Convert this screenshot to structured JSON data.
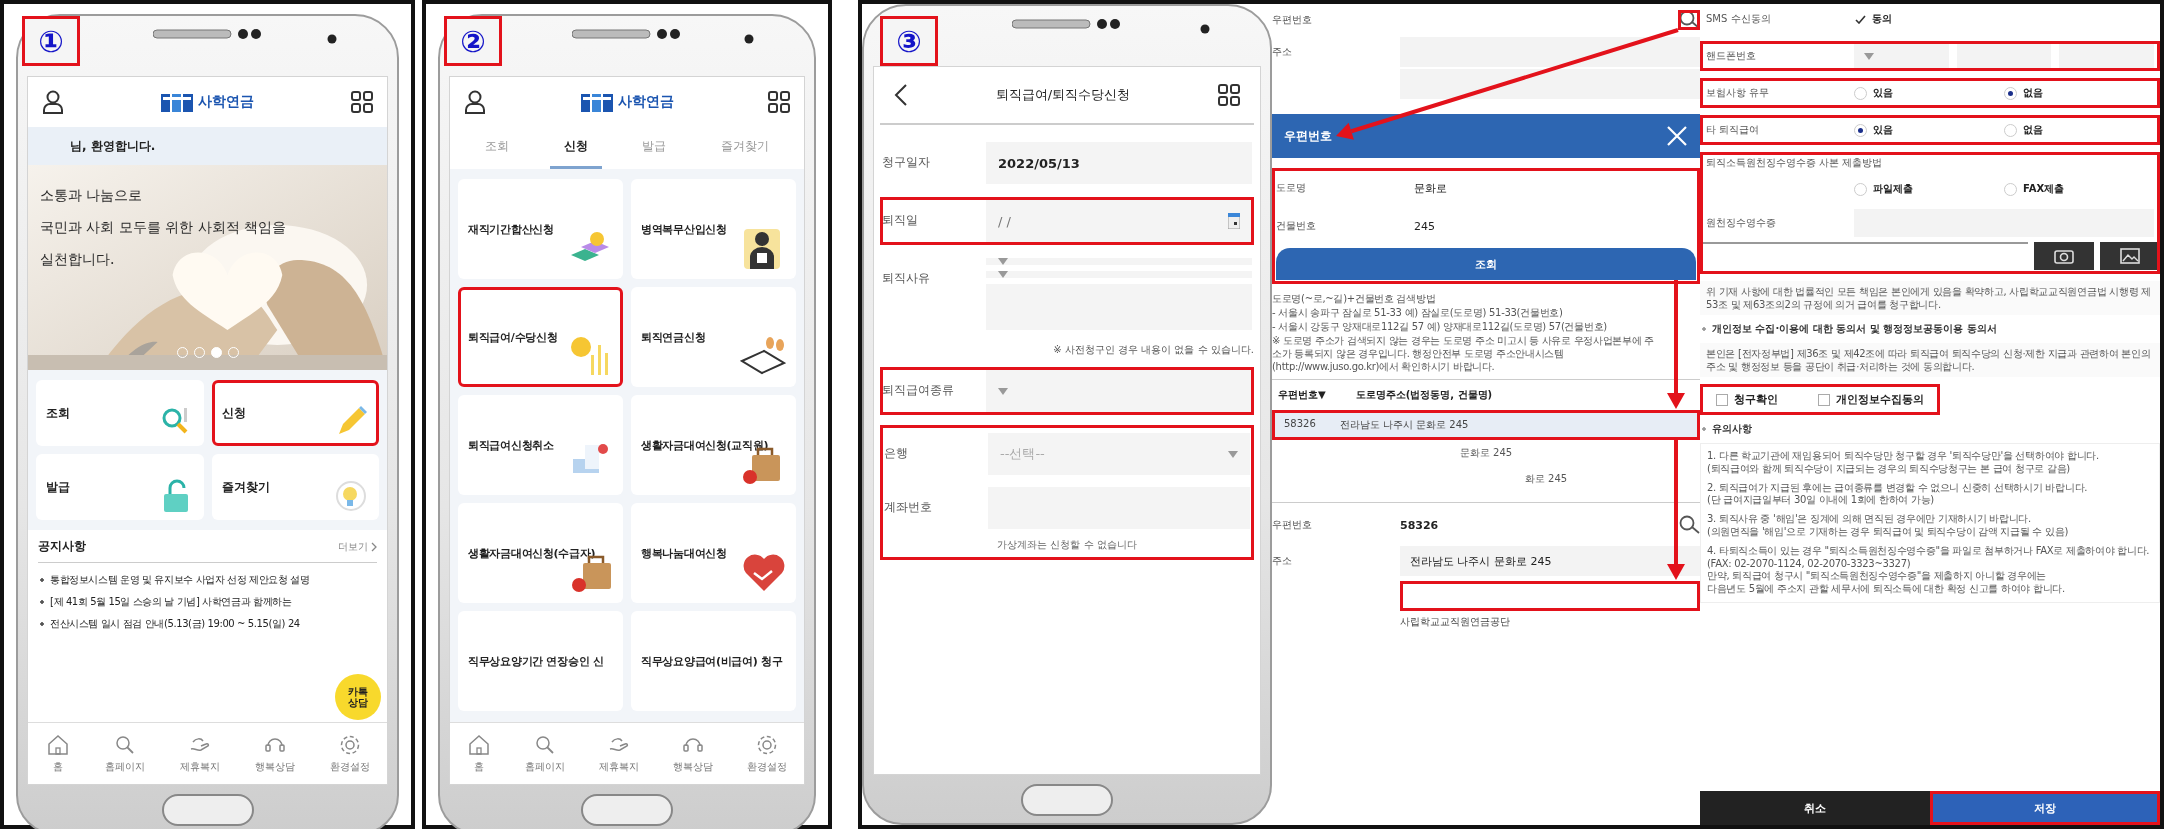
{
  "panels": [
    {
      "kind": "home",
      "step": "①",
      "header": {
        "logo": "사학연금"
      },
      "welcome": "님, 환영합니다.",
      "banner": {
        "lines": [
          "소통과 나눔으로",
          "국민과 사회 모두를 위한 사회적 책임을",
          "실천합니다."
        ],
        "dots": [
          {
            "selected": false
          },
          {
            "selected": false
          },
          {
            "selected": true
          },
          {
            "selected": false
          }
        ]
      },
      "tiles": [
        {
          "label": "조회",
          "highlighted": false
        },
        {
          "label": "신청",
          "highlighted": true
        },
        {
          "label": "발급",
          "highlighted": false
        },
        {
          "label": "즐겨찾기",
          "highlighted": false
        }
      ],
      "notice": {
        "title": "공지사항",
        "more": "더보기",
        "items": [
          "통합정보시스템 운영 및 유지보수 사업자 선정 제안요청 설명",
          "[제 41회 5월 15일 스승의 날 기념] 사학연금과 함께하는",
          "전산시스템 일시 점검 안내(5.13(금) 19:00 ~ 5.15(일) 24"
        ]
      },
      "chat_button": "카톡 상담",
      "nav": [
        "홈",
        "홈페이지",
        "제휴복지",
        "행복상담",
        "환경설정"
      ]
    },
    {
      "kind": "apply",
      "step": "②",
      "header": {
        "logo": "사학연금"
      },
      "tabs": [
        {
          "label": "조회",
          "selected": false
        },
        {
          "label": "신청",
          "selected": true
        },
        {
          "label": "발급",
          "selected": false
        },
        {
          "label": "즐겨찾기",
          "selected": false
        }
      ],
      "tiles": [
        {
          "label": "재직기간합산신청",
          "highlighted": false
        },
        {
          "label": "병역복무산입신청",
          "highlighted": false
        },
        {
          "label": "퇴직급여/수당신청",
          "highlighted": true
        },
        {
          "label": "퇴직연금신청",
          "highlighted": false
        },
        {
          "label": "퇴직급여신청취소",
          "highlighted": false
        },
        {
          "label": "생활자금대여신청(교직원)",
          "highlighted": false
        },
        {
          "label": "생활자금대여신청(수급자)",
          "highlighted": false
        },
        {
          "label": "행복나눔대여신청",
          "highlighted": false
        },
        {
          "label": "직무상요양기간 연장승인 신",
          "highlighted": false
        },
        {
          "label": "직무상요양급여(비급여) 청구",
          "highlighted": false
        }
      ],
      "nav": [
        "홈",
        "홈페이지",
        "제휴복지",
        "행복상담",
        "환경설정"
      ]
    },
    {
      "kind": "composite",
      "step": "③",
      "form": {
        "title": "퇴직급여/퇴직수당신청",
        "rows": [
          {
            "kind": "text",
            "label": "청구일자",
            "value": "2022/05/13",
            "highlighted": false
          },
          {
            "kind": "date",
            "label": "퇴직일",
            "placeholder": "/ /",
            "highlighted": true
          },
          {
            "kind": "reason",
            "label": "퇴직사유",
            "highlighted": false
          },
          {
            "kind": "note",
            "text": "※ 사전청구인 경우 내용이 없을 수 있습니다.",
            "highlighted": false
          },
          {
            "kind": "select",
            "label": "퇴직급여종류",
            "highlighted": true
          },
          {
            "kind": "account",
            "bank_label": "은행",
            "bank_placeholder": "--선택--",
            "account_label": "계좌번호",
            "note": "가상계좌는 신청할 수 없습니다",
            "highlighted": true
          }
        ]
      },
      "zip": {
        "top": {
          "zip_label": "우편번호",
          "search_highlighted": true,
          "address_label": "주소"
        },
        "popup": {
          "title": "우편번호",
          "fields_highlighted": true,
          "fields": [
            {
              "label": "도로명",
              "value": "문화로"
            },
            {
              "label": "건물번호",
              "value": "245"
            }
          ],
          "button": "조회",
          "help": [
            "도로명(~로,~길)+건물번호 검색방법",
            "- 서울시 송파구 잠실로 51-33 예) 잠실로(도로명) 51-33(건물번호)",
            "- 서울시 강동구 양재대로112길 57 예) 양재대로112길(도로명) 57(건물번호)",
            "※ 도로명 주소가 검색되지 않는 경우는 도로명 주소 미고시 등 사유로 우정사업본부에 주소가 등록되지 않은 경우입니다. 행정안전부 도로명 주소안내시스템(http://www.juso.go.kr)에서 확인하시기 바랍니다."
          ],
          "columns": [
            "우편번호▼",
            "도로명주소(법정동명, 건물명)"
          ],
          "rows": [
            {
              "zip": "58326",
              "address": "전라남도 나주시 문화로 245",
              "highlighted": true
            }
          ],
          "more": [
            "문화로 245",
            "화로 245"
          ]
        },
        "result": {
          "zip_label": "우편번호",
          "zip": "58326",
          "address_label": "주소",
          "address": "전라남도 나주시 문화로 245",
          "detail_highlighted": true,
          "footer": "사립학교교직원연금공단"
        }
      },
      "consent": {
        "sms": {
          "label": "SMS 수신동의",
          "option": "동의",
          "checked": true
        },
        "phone": {
          "label": "핸드폰번호",
          "highlighted": true
        },
        "radio_rows": [
          {
            "label": "보험사항 유무",
            "highlighted": true,
            "options": [
              {
                "label": "있음",
                "selected": false
              },
              {
                "label": "없음",
                "selected": true
              }
            ]
          },
          {
            "label": "타 퇴직급여",
            "highlighted": true,
            "options": [
              {
                "label": "있음",
                "selected": true
              },
              {
                "label": "없음",
                "selected": false
              }
            ]
          }
        ],
        "submission": {
          "highlighted": true,
          "title": "퇴직소득원천징수영수증 사본 제출방법",
          "options": [
            {
              "label": "파일제출",
              "selected": false
            },
            {
              "label": "FAX제출",
              "selected": false
            }
          ],
          "file_label": "원천징수영수증"
        },
        "declaration": "위 기재 사항에 대한 법률적인 모든 책임은 본인에게 있음을 확약하고, 사립학교교직원연금법 시행령 제53조 및 제63조의2의 규정에 의거 급여를 청구합니다.",
        "privacy_title": "개인정보 수집·이용에 대한 동의서 및 행정정보공동이용 동의서",
        "privacy_text": "본인은 [전자정부법] 제36조 및 제42조에 따라 퇴직급여 퇴직수당의 신청·제한 지급과 관련하여 본인의 주소 및 행정정보 등을 공단이 취급·처리하는 것에 동의합니다.",
        "checks": {
          "highlighted": true,
          "items": [
            {
              "label": "청구확인",
              "checked": false
            },
            {
              "label": "개인정보수집동의",
              "checked": false
            }
          ]
        },
        "notes_title": "유의사항",
        "notes": [
          "1. 다른 학교기관에 재임용되어 퇴직수당만 청구할 경우 '퇴직수당만'을 선택하여야 합니다.\n(퇴직급여와 함께 퇴직수당이 지급되는 경우의 퇴직수당청구는 본 급여 청구로 갈음)",
          "2. 퇴직급여가 지급된 후에는 급여종류를 변경할 수 없으니 신중히 선택하시기 바랍니다.\n(단 급여지급일부터 30일 이내에 1회에 한하여 가능)",
          "3. 퇴직사유 중 '해임'은 징계에 의해 면직된 경우에만 기재하시기 바랍니다.\n(의원면직을 '해임'으로 기재하는 경우 퇴직급여 및 퇴직수당이 감액 지급될 수 있음)",
          "4. 타퇴직소득이 있는 경우 \"퇴직소득원천징수영수증\"을 파일로 첨부하거나 FAX로 제출하여야 합니다. (FAX: 02-2070-1124, 02-2070-3323~3327)\n만약, 퇴직급여 청구시 \"퇴직소득원천징수영수증\"을 제출하지 아니할 경우에는\n다음년도 5월에 주소지 관할 세무서에 퇴직소득에 대한 확정 신고를 하여야 합니다."
        ],
        "buttons": [
          {
            "label": "취소",
            "kind": "cancel",
            "highlighted": false
          },
          {
            "label": "저장",
            "kind": "save",
            "highlighted": true
          }
        ]
      }
    }
  ]
}
